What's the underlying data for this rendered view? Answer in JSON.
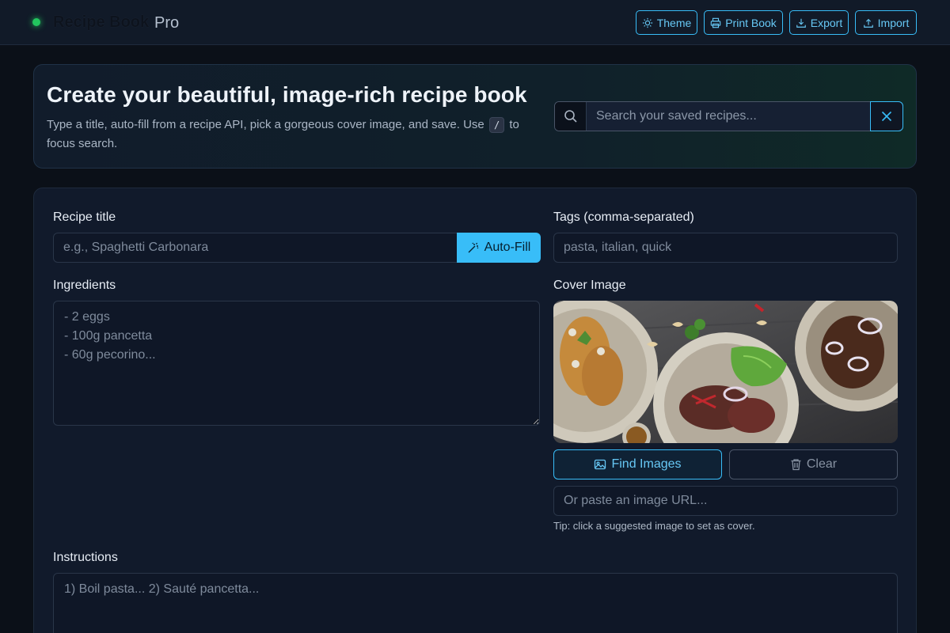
{
  "header": {
    "brand": "Recipe Book",
    "brand_suffix": "Pro",
    "buttons": {
      "theme": "Theme",
      "print": "Print Book",
      "export": "Export",
      "import": "Import"
    }
  },
  "hero": {
    "title": "Create your beautiful, image-rich recipe book",
    "desc_before": "Type a title, auto-fill from a recipe API, pick a gorgeous cover image, and save. Use",
    "kbd": "/",
    "desc_after": "to focus search.",
    "search_placeholder": "Search your saved recipes..."
  },
  "form": {
    "title_label": "Recipe title",
    "title_placeholder": "e.g., Spaghetti Carbonara",
    "autofill_label": "Auto-Fill",
    "tags_label": "Tags (comma-separated)",
    "tags_placeholder": "pasta, italian, quick",
    "ingredients_label": "Ingredients",
    "ingredients_placeholder": "- 2 eggs\n- 100g pancetta\n- 60g pecorino...",
    "cover_label": "Cover Image",
    "find_images_label": "Find Images",
    "clear_label": "Clear",
    "image_url_placeholder": "Or paste an image URL...",
    "tip": "Tip: click a suggested image to set as cover.",
    "instructions_label": "Instructions",
    "instructions_placeholder": "1) Boil pasta... 2) Sauté pancetta..."
  },
  "colors": {
    "accent": "#38bdf8",
    "status_dot": "#22c55e",
    "background": "#0b1018"
  }
}
